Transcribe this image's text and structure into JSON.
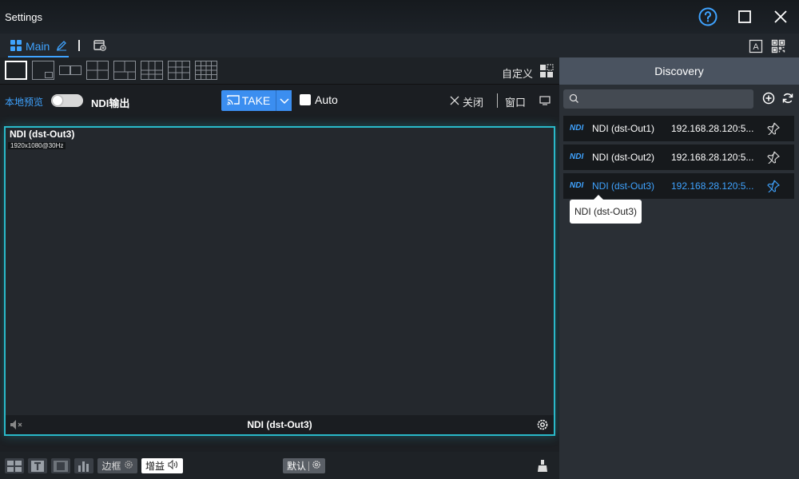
{
  "window": {
    "title": "Settings"
  },
  "tabs": {
    "main_label": "Main"
  },
  "layout_bar": {
    "custom_label": "自定义"
  },
  "controls": {
    "local_preview_label": "本地预览",
    "local_preview_on": false,
    "ndi_output_label": "NDI输出",
    "take_label": "TAKE",
    "auto_label": "Auto",
    "auto_checked": false,
    "close_label": "关闭",
    "window_label": "窗口"
  },
  "preview": {
    "source_name": "NDI (dst-Out3)",
    "resolution": "1920x1080@30Hz",
    "footer_name": "NDI (dst-Out3)"
  },
  "bottom_bar": {
    "border_label": "边框",
    "gain_label": "增益",
    "default_label": "默认"
  },
  "discovery": {
    "title": "Discovery",
    "search_placeholder": "",
    "devices": [
      {
        "logo": "NDI",
        "name": "NDI (dst-Out1)",
        "ip": "192.168.28.120:5..."
      },
      {
        "logo": "NDI",
        "name": "NDI (dst-Out2)",
        "ip": "192.168.28.120:5..."
      },
      {
        "logo": "NDI",
        "name": "NDI (dst-Out3)",
        "ip": "192.168.28.120:5..."
      }
    ],
    "selected_index": 2,
    "tooltip": "NDI (dst-Out3)"
  },
  "colors": {
    "accent": "#3fa3ff",
    "highlight_border": "#29b9c9",
    "take_button": "#3b8ef0"
  },
  "icons": [
    "help-icon",
    "maximize-icon",
    "close-icon",
    "grid-icon",
    "edit-icon",
    "add-window-icon",
    "text-overlay-icon",
    "qr-code-icon",
    "custom-layout-icon",
    "cast-icon",
    "chevron-down-icon",
    "monitor-icon",
    "mute-icon",
    "settings-icon",
    "search-icon",
    "add-circle-icon",
    "refresh-icon",
    "pin-icon",
    "brush-icon"
  ]
}
